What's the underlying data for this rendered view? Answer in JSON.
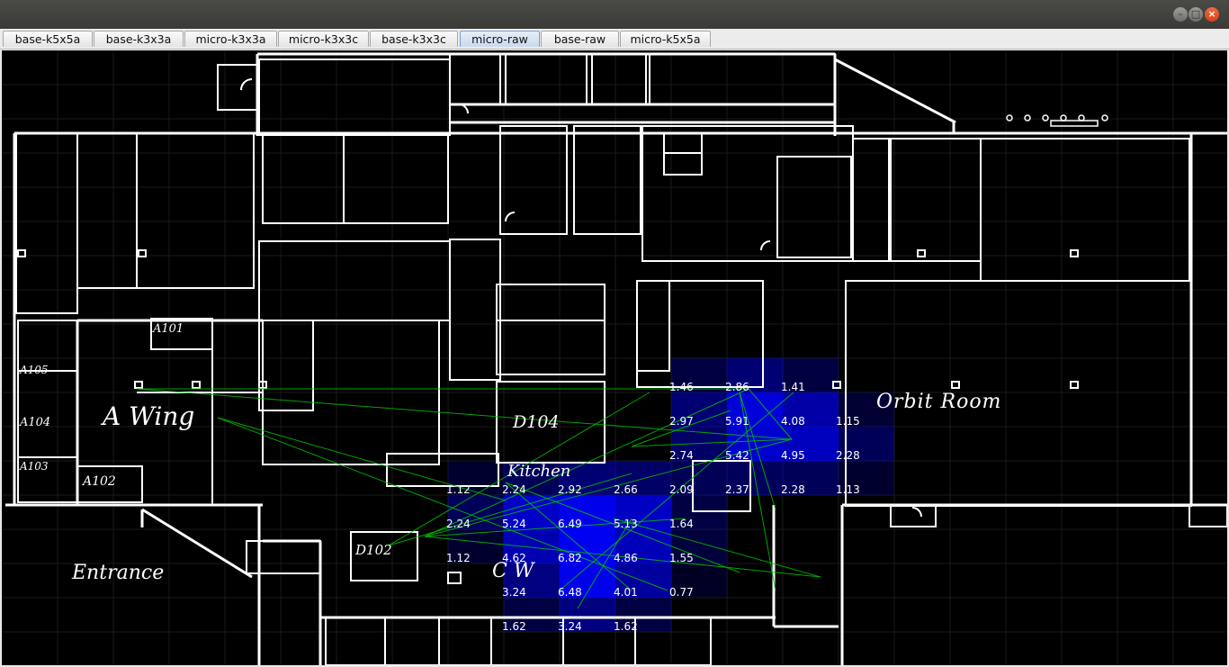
{
  "window": {
    "controls": {
      "minimize": "–",
      "maximize": "□",
      "close": "×"
    }
  },
  "tabs": [
    {
      "label": "base-k5x5a",
      "active": false
    },
    {
      "label": "base-k3x3a",
      "active": false
    },
    {
      "label": "micro-k3x3a",
      "active": false
    },
    {
      "label": "micro-k3x3c",
      "active": false
    },
    {
      "label": "base-k3x3c",
      "active": false
    },
    {
      "label": "micro-raw",
      "active": true
    },
    {
      "label": "base-raw",
      "active": false
    },
    {
      "label": "micro-k5x5a",
      "active": false
    }
  ],
  "map": {
    "rooms": {
      "a_wing": "A Wing",
      "orbit_room": "Orbit Room",
      "entrance": "Entrance",
      "kitchen": "Kitchen",
      "d104": "D104",
      "d102": "D102",
      "a101": "A101",
      "a102": "A102",
      "a103": "A103",
      "a104": "A104",
      "a105": "A105",
      "cw": "C W"
    },
    "colors": {
      "background": "#000000",
      "walls": "#ffffff",
      "heat": "#0000ff",
      "lines": "#00c000"
    },
    "heatmap_values": [
      "1.46",
      "2.86",
      "1.41",
      "2.97",
      "5.91",
      "4.08",
      "1.15",
      "2.74",
      "5.42",
      "4.95",
      "2.28",
      "1.12",
      "2.24",
      "2.92",
      "2.66",
      "2.09",
      "2.37",
      "2.28",
      "1.13",
      "2.24",
      "5.24",
      "6.49",
      "5.13",
      "1.64",
      "1.12",
      "4.62",
      "6.82",
      "4.86",
      "1.55",
      "3.24",
      "6.48",
      "4.01",
      "0.77",
      "1.62",
      "3.24",
      "1.62"
    ]
  }
}
